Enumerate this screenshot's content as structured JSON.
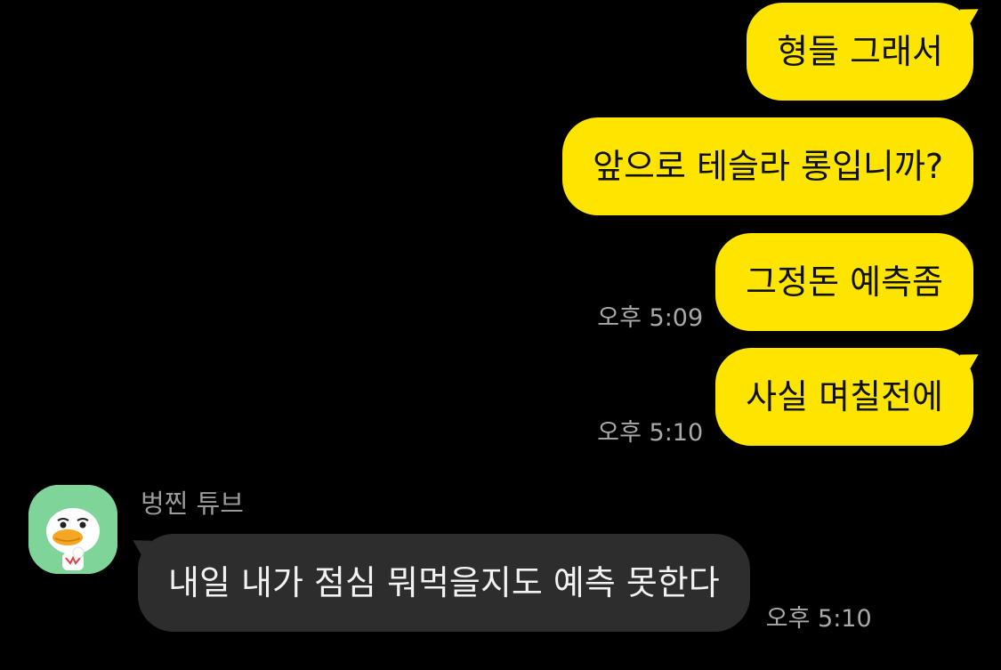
{
  "outgoing_messages": [
    {
      "text": "형들 그래서",
      "time": ""
    },
    {
      "text": "앞으로 테슬라 롱입니까?",
      "time": ""
    },
    {
      "text": "그정돈 예측좀",
      "time": "오후 5:09"
    },
    {
      "text": "사실 며칠전에",
      "time": "오후 5:10"
    }
  ],
  "incoming_message": {
    "sender": "벙찐 튜브",
    "avatar_icon": "duck-character-avatar",
    "text": "내일 내가 점심 뭐먹을지도 예측 못한다",
    "time": "오후 5:10"
  },
  "colors": {
    "background": "#000000",
    "outgoing_bubble": "#fee500",
    "incoming_bubble": "#2d2d2d",
    "timestamp": "#a9a9a9"
  }
}
